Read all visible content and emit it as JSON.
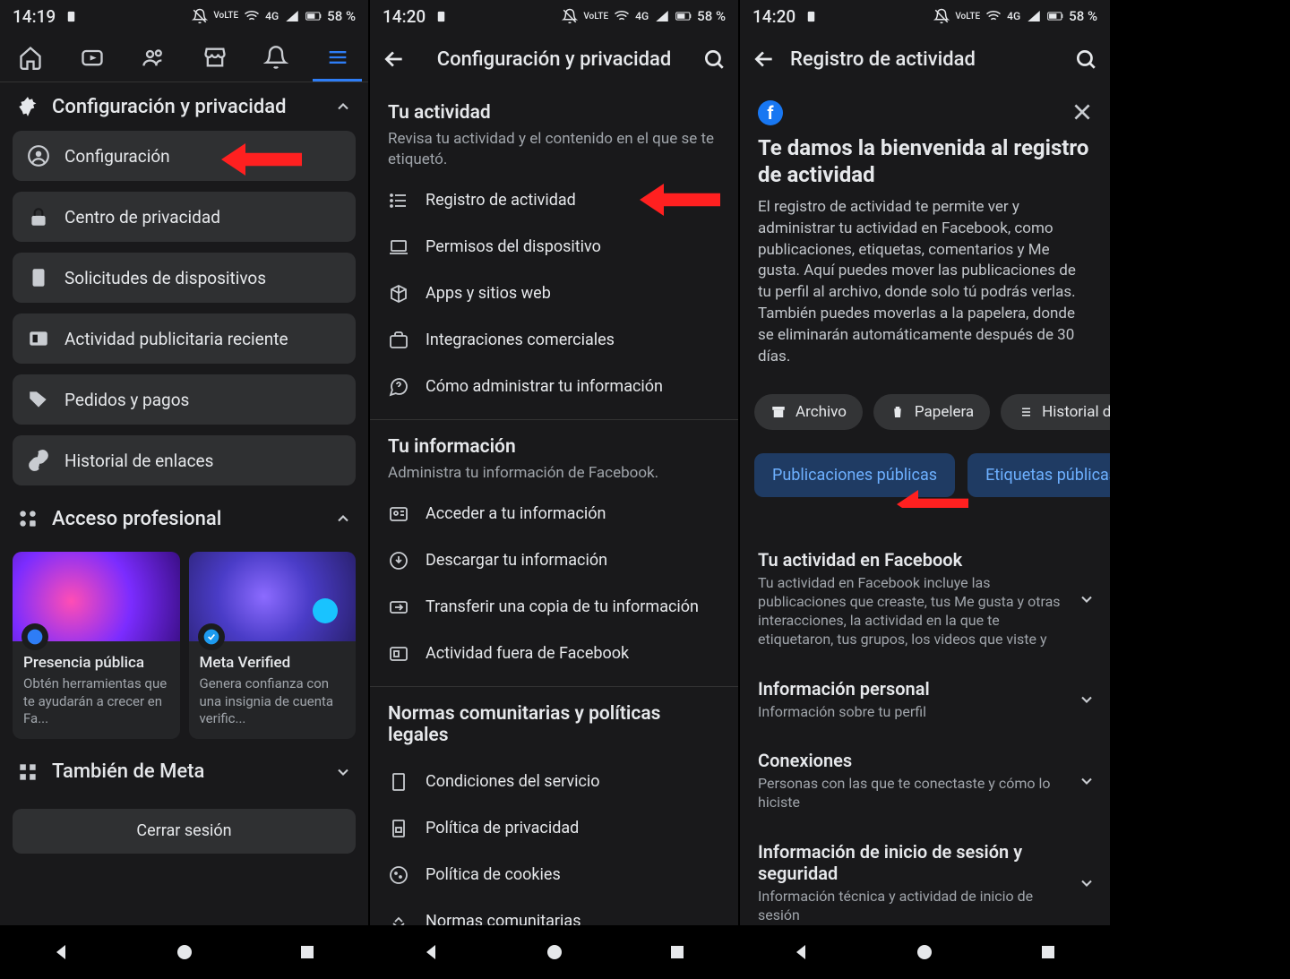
{
  "status": {
    "time1": "14:19",
    "time2": "14:20",
    "net": "4G",
    "lte": "VoLTE",
    "batt": "58 %",
    "batt_icon": "58"
  },
  "screen1": {
    "section_settings": "Configuración y privacidad",
    "items": [
      "Configuración",
      "Centro de privacidad",
      "Solicitudes de dispositivos",
      "Actividad publicitaria reciente",
      "Pedidos y pagos",
      "Historial de enlaces"
    ],
    "section_pro": "Acceso profesional",
    "cards": [
      {
        "title": "Presencia pública",
        "sub": "Obtén herramientas que te ayudarán a crecer en Fa..."
      },
      {
        "title": "Meta Verified",
        "sub": "Genera confianza con una insignia de cuenta verific..."
      }
    ],
    "section_meta": "También de Meta",
    "logout": "Cerrar sesión"
  },
  "screen2": {
    "title": "Configuración y privacidad",
    "activity": {
      "title": "Tu actividad",
      "sub": "Revisa tu actividad y el contenido en el que se te etiquetó."
    },
    "activity_items": [
      "Registro de actividad",
      "Permisos del dispositivo",
      "Apps y sitios web",
      "Integraciones comerciales",
      "Cómo administrar tu información"
    ],
    "info": {
      "title": "Tu información",
      "sub": "Administra tu información de Facebook."
    },
    "info_items": [
      "Acceder a tu información",
      "Descargar tu información",
      "Transferir una copia de tu información",
      "Actividad fuera de Facebook"
    ],
    "legal": {
      "title": "Normas comunitarias y políticas legales"
    },
    "legal_items": [
      "Condiciones del servicio",
      "Política de privacidad",
      "Política de cookies",
      "Normas comunitarias"
    ]
  },
  "screen3": {
    "title": "Registro de actividad",
    "welcome_title": "Te damos la bienvenida al registro de actividad",
    "welcome_body": "El registro de actividad te permite ver y administrar tu actividad en Facebook, como publicaciones, etiquetas, comentarios y Me gusta. Aquí puedes mover las publicaciones de tu perfil al archivo, donde solo tú podrás verlas. También puedes moverlas a la papelera, donde se eliminarán automáticamente después de 30 días.",
    "chips": [
      "Archivo",
      "Papelera",
      "Historial de activid"
    ],
    "tabs": [
      "Publicaciones públicas",
      "Etiquetas públicas"
    ],
    "cats": [
      {
        "title": "Tu actividad en Facebook",
        "sub": "Tu actividad en Facebook incluye las publicaciones que creaste, tus Me gusta y otras interacciones, la actividad en la que te etiquetaron, tus grupos, los videos que viste y"
      },
      {
        "title": "Información personal",
        "sub": "Información sobre tu perfil"
      },
      {
        "title": "Conexiones",
        "sub": "Personas con las que te conectaste y cómo lo hiciste"
      },
      {
        "title": "Información de inicio de sesión y seguridad",
        "sub": "Información técnica y actividad de inicio de sesión"
      }
    ]
  }
}
